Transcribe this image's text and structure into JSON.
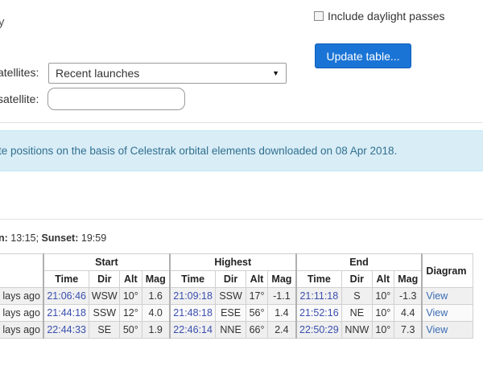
{
  "fragments": {
    "top_left": "y"
  },
  "options": {
    "daylight_label": "Include daylight passes",
    "daylight_checked": false,
    "update_button": "Update table..."
  },
  "form": {
    "satellites_label": "atellites:",
    "satellites_value": "Recent launches",
    "satellite_label": "satellite:",
    "satellite_input_value": ""
  },
  "info_banner": "te positions on the basis of Celestrak orbital elements downloaded on 08 Apr 2018.",
  "sun": {
    "rise_label": "n:",
    "rise_time": "13:15;",
    "set_label": "Sunset:",
    "set_time": "19:59"
  },
  "table": {
    "groups": [
      "Start",
      "Highest",
      "End"
    ],
    "columns": [
      "Time",
      "Dir",
      "Alt",
      "Mag"
    ],
    "diagram_header": "Diagram",
    "rows": [
      {
        "date": "lays ago",
        "start": {
          "time": "21:06:46",
          "dir": "WSW",
          "alt": "10°",
          "mag": "1.6"
        },
        "highest": {
          "time": "21:09:18",
          "dir": "SSW",
          "alt": "17°",
          "mag": "-1.1"
        },
        "end": {
          "time": "21:11:18",
          "dir": "S",
          "alt": "10°",
          "mag": "-1.3"
        },
        "diagram": "View"
      },
      {
        "date": "lays ago",
        "start": {
          "time": "21:44:18",
          "dir": "SSW",
          "alt": "12°",
          "mag": "4.0"
        },
        "highest": {
          "time": "21:48:18",
          "dir": "ESE",
          "alt": "56°",
          "mag": "1.4"
        },
        "end": {
          "time": "21:52:16",
          "dir": "NE",
          "alt": "10°",
          "mag": "4.4"
        },
        "diagram": "View"
      },
      {
        "date": "lays ago",
        "start": {
          "time": "22:44:33",
          "dir": "SE",
          "alt": "50°",
          "mag": "1.9"
        },
        "highest": {
          "time": "22:46:14",
          "dir": "NNE",
          "alt": "66°",
          "mag": "2.4"
        },
        "end": {
          "time": "22:50:29",
          "dir": "NNW",
          "alt": "10°",
          "mag": "7.3"
        },
        "diagram": "View"
      }
    ]
  }
}
